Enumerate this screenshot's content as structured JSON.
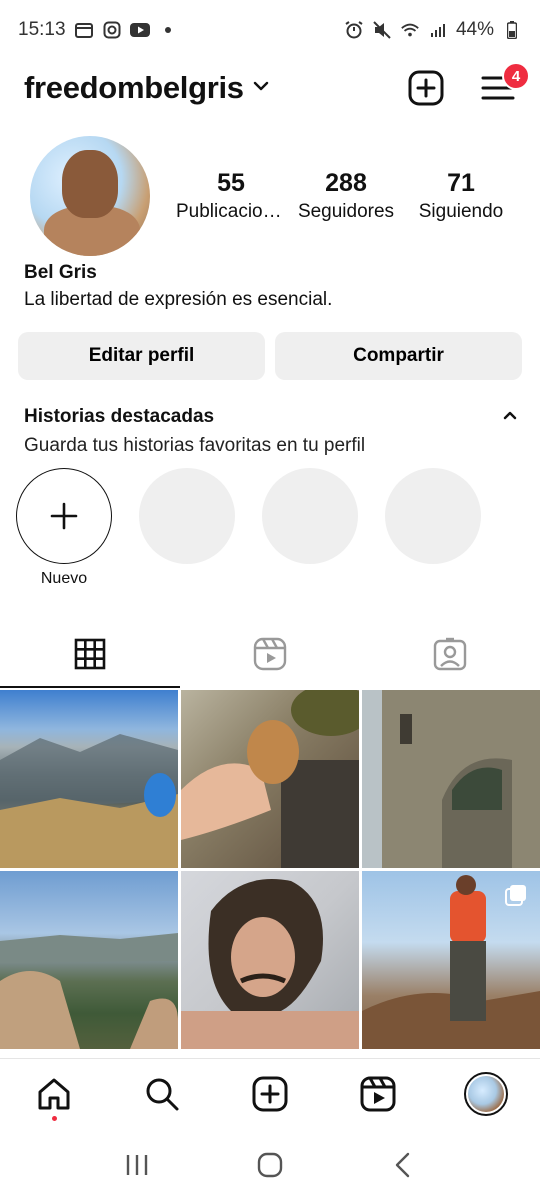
{
  "status_bar": {
    "time": "15:13",
    "battery": "44%",
    "left_icons": [
      "calendar-icon",
      "instagram-icon",
      "youtube-icon",
      "dot-icon"
    ],
    "right_icons": [
      "alarm-icon",
      "mute-icon",
      "wifi-icon",
      "signal-icon",
      "battery-icon"
    ]
  },
  "header": {
    "username": "freedombelgris",
    "notification_count": "4"
  },
  "profile": {
    "stats": [
      {
        "value": "55",
        "label": "Publicaciones"
      },
      {
        "value": "288",
        "label": "Seguidores"
      },
      {
        "value": "71",
        "label": "Siguiendo"
      }
    ],
    "name": "Bel Gris",
    "bio": "La libertad de expresión es esencial."
  },
  "buttons": {
    "edit": "Editar perfil",
    "share": "Compartir"
  },
  "highlights": {
    "title": "Historias destacadas",
    "subtitle": "Guarda tus historias favoritas en tu perfil",
    "new_label": "Nuevo"
  },
  "tabs": [
    "grid-icon",
    "reels-icon",
    "tagged-icon"
  ],
  "colors": {
    "badge": "#ef2c40",
    "button_bg": "#efefef",
    "text": "#111111"
  }
}
